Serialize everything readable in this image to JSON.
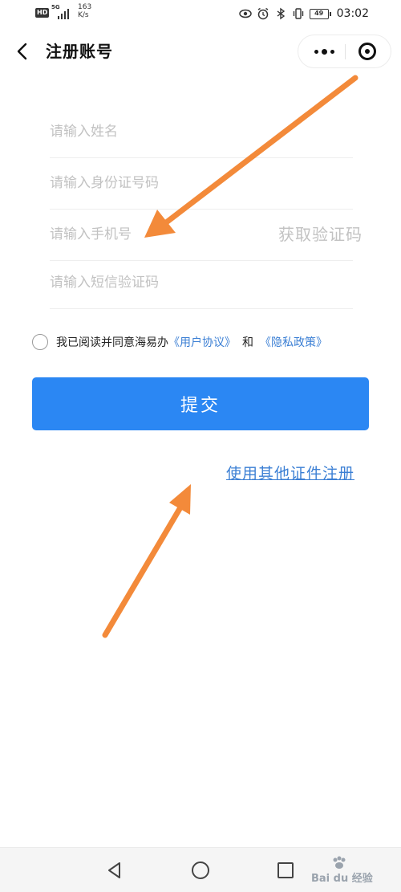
{
  "status_bar": {
    "hd": "HD",
    "network": "5G",
    "speed_value": "163",
    "speed_unit": "K/s",
    "battery": "49",
    "time": "03:02"
  },
  "nav": {
    "title": "注册账号"
  },
  "form": {
    "name_placeholder": "请输入姓名",
    "id_placeholder": "请输入身份证号码",
    "phone_placeholder": "请输入手机号",
    "get_code": "获取验证码",
    "sms_placeholder": "请输入短信验证码"
  },
  "agreement": {
    "prefix": "我已阅读并同意海易办",
    "user_agreement": "《用户协议》",
    "and": "和",
    "privacy_policy": "《隐私政策》"
  },
  "submit_label": "提交",
  "other_register": "使用其他证件注册",
  "watermark": "Bai du 经验",
  "colors": {
    "primary": "#2b87f3",
    "link": "#3b7fd4",
    "arrow": "#f38a3a"
  }
}
